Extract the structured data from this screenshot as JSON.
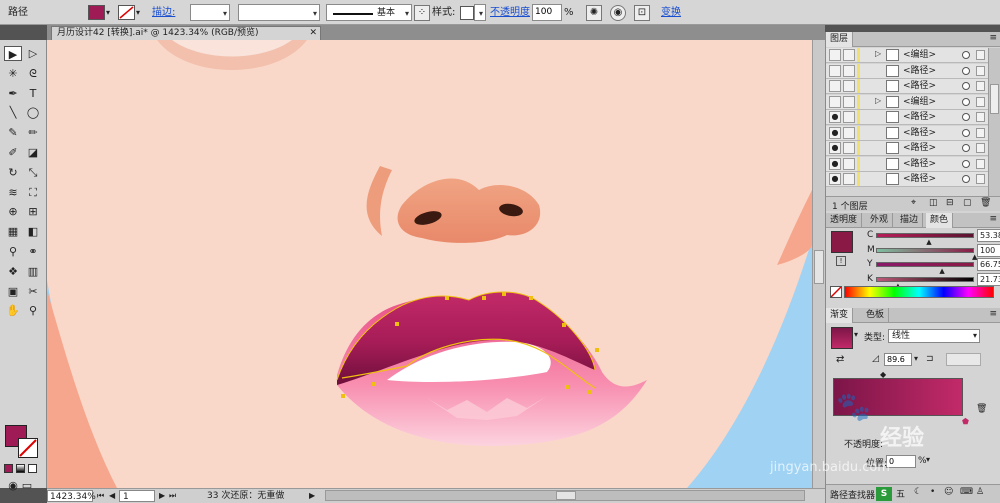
{
  "control_bar": {
    "path_label": "路径",
    "fill_color": "#9e1b55",
    "stroke_link": "描边:",
    "profile_label": "基本",
    "style_label": "样式:",
    "opacity_link": "不透明度",
    "opacity_value": "100",
    "percent": "%",
    "transform_link": "变换"
  },
  "document": {
    "tab_title": "月历设计42 [转换].ai* @ 1423.34% (RGB/预览)",
    "close_glyph": "✕"
  },
  "tools": [
    {
      "icon": "selection-icon",
      "glyph": "▶"
    },
    {
      "icon": "direct-selection-icon",
      "glyph": "▷"
    },
    {
      "icon": "magic-wand-icon",
      "glyph": "✳"
    },
    {
      "icon": "lasso-icon",
      "glyph": "ᘓ"
    },
    {
      "icon": "pen-icon",
      "glyph": "✒"
    },
    {
      "icon": "type-icon",
      "glyph": "T"
    },
    {
      "icon": "line-icon",
      "glyph": "╲"
    },
    {
      "icon": "ellipse-icon",
      "glyph": "◯"
    },
    {
      "icon": "paintbrush-icon",
      "glyph": "✎"
    },
    {
      "icon": "pencil-icon",
      "glyph": "✏"
    },
    {
      "icon": "blob-brush-icon",
      "glyph": "✐"
    },
    {
      "icon": "eraser-icon",
      "glyph": "◪"
    },
    {
      "icon": "rotate-icon",
      "glyph": "↻"
    },
    {
      "icon": "scale-icon",
      "glyph": "⤡"
    },
    {
      "icon": "warp-icon",
      "glyph": "≋"
    },
    {
      "icon": "free-transform-icon",
      "glyph": "⛶"
    },
    {
      "icon": "shape-builder-icon",
      "glyph": "⊕"
    },
    {
      "icon": "perspective-icon",
      "glyph": "⊞"
    },
    {
      "icon": "mesh-icon",
      "glyph": "▦"
    },
    {
      "icon": "gradient-icon",
      "glyph": "◧"
    },
    {
      "icon": "eyedropper-icon",
      "glyph": "⚲"
    },
    {
      "icon": "blend-icon",
      "glyph": "⚭"
    },
    {
      "icon": "symbol-sprayer-icon",
      "glyph": "❖"
    },
    {
      "icon": "graph-icon",
      "glyph": "▥"
    },
    {
      "icon": "artboard-icon",
      "glyph": "▣"
    },
    {
      "icon": "slice-icon",
      "glyph": "✂"
    },
    {
      "icon": "hand-icon",
      "glyph": "✋"
    },
    {
      "icon": "zoom-icon",
      "glyph": "⚲"
    }
  ],
  "status_bar": {
    "zoom": "1423.34",
    "page": "1",
    "message": "33 次还原：无重做"
  },
  "layers_panel": {
    "title": "图层",
    "rows": [
      {
        "name": "<编组>",
        "twirl": true
      },
      {
        "name": "<路径>",
        "twirl": false
      },
      {
        "name": "<路径>",
        "twirl": false
      },
      {
        "name": "<编组>",
        "twirl": true
      },
      {
        "name": "<路径>",
        "twirl": false
      },
      {
        "name": "<路径>",
        "twirl": false
      },
      {
        "name": "<路径>",
        "twirl": false
      },
      {
        "name": "<路径>",
        "twirl": false
      },
      {
        "name": "<路径>",
        "twirl": false
      }
    ],
    "footer": "1 个图层"
  },
  "color_panel": {
    "tabs": [
      "透明度",
      "外观",
      "描边",
      "颜色"
    ],
    "channels": [
      {
        "label": "C",
        "value": "53.38"
      },
      {
        "label": "M",
        "value": "100"
      },
      {
        "label": "Y",
        "value": "66.75"
      },
      {
        "label": "K",
        "value": "21.73"
      }
    ],
    "percent": "%",
    "swatch": "#8a1a45"
  },
  "gradient_panel": {
    "tabs": [
      "渐变",
      "色板"
    ],
    "type_label": "类型:",
    "type_value": "线性",
    "angle": "89.6",
    "opacity_label": "不透明度:",
    "location_label": "位置:",
    "location_value": "0",
    "start_color": "#7c1548",
    "end_color": "#c22a68"
  },
  "find_bar": {
    "label": "路径查找器"
  },
  "watermark": {
    "text": "经验",
    "url": "jingyan.baidu.com"
  }
}
